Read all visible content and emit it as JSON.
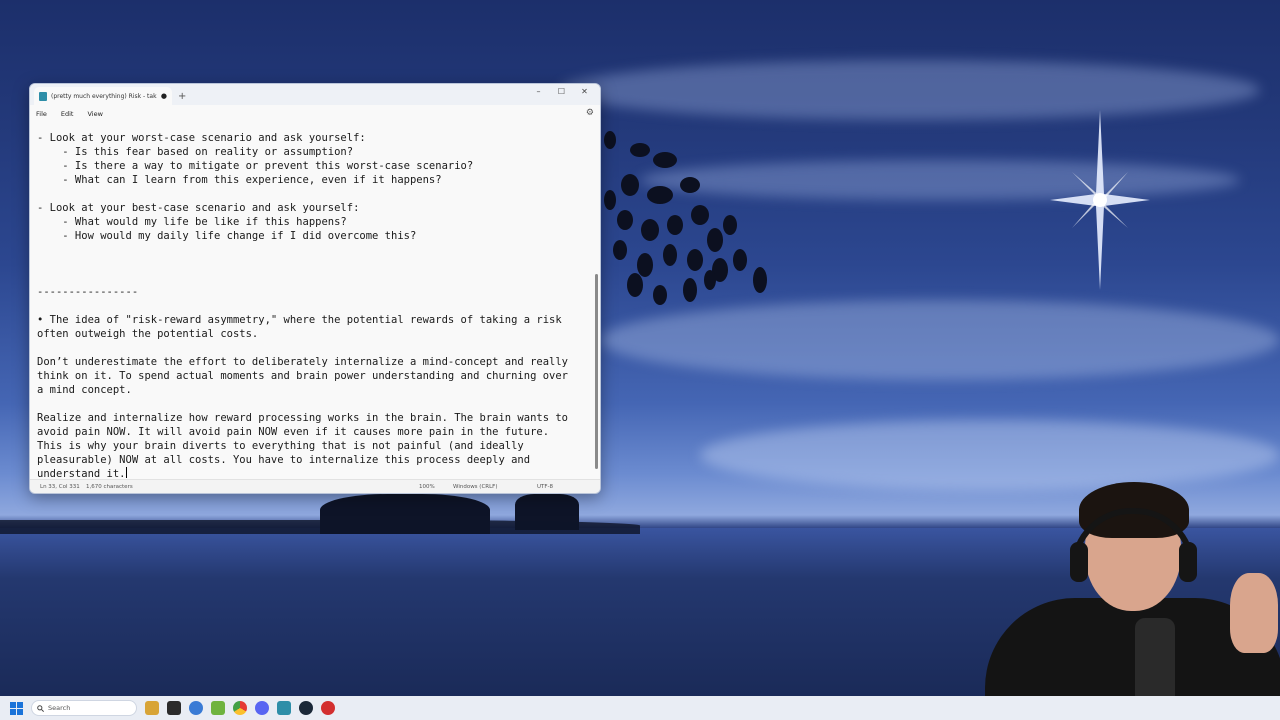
{
  "window": {
    "tab_title": "(pretty much everything) Risk - tak",
    "tab_modified": "●",
    "new_tab": "+",
    "minimize": "–",
    "maximize": "☐",
    "close": "✕"
  },
  "menu": {
    "file": "File",
    "edit": "Edit",
    "view": "View",
    "settings_icon": "⚙"
  },
  "editor": {
    "lines": [
      "- Look at your worst-case scenario and ask yourself:",
      "    - Is this fear based on reality or assumption?",
      "    - Is there a way to mitigate or prevent this worst-case scenario?",
      "    - What can I learn from this experience, even if it happens?",
      "",
      "- Look at your best-case scenario and ask yourself:",
      "    - What would my life be like if this happens?",
      "    - How would my daily life change if I did overcome this?",
      "",
      "",
      "",
      "----------------",
      "",
      "• The idea of \"risk-reward asymmetry,\" where the potential rewards of taking a risk",
      "often outweigh the potential costs.",
      "",
      "Don’t underestimate the effort to deliberately internalize a mind-concept and really",
      "think on it. To spend actual moments and brain power understanding and churning over",
      "a mind concept.",
      "",
      "Realize and internalize how reward processing works in the brain. The brain wants to",
      "avoid pain NOW. It will avoid pain NOW even if it causes more pain in the future.",
      "This is why your brain diverts to everything that is not painful (and ideally",
      "pleasurable) NOW at all costs. You have to internalize this process deeply and",
      "understand it."
    ]
  },
  "status": {
    "position": "Ln 33, Col 331",
    "characters": "1,670 characters",
    "zoom": "100%",
    "line_ending": "Windows (CRLF)",
    "encoding": "UTF-8"
  },
  "taskbar": {
    "search_placeholder": "Search"
  }
}
